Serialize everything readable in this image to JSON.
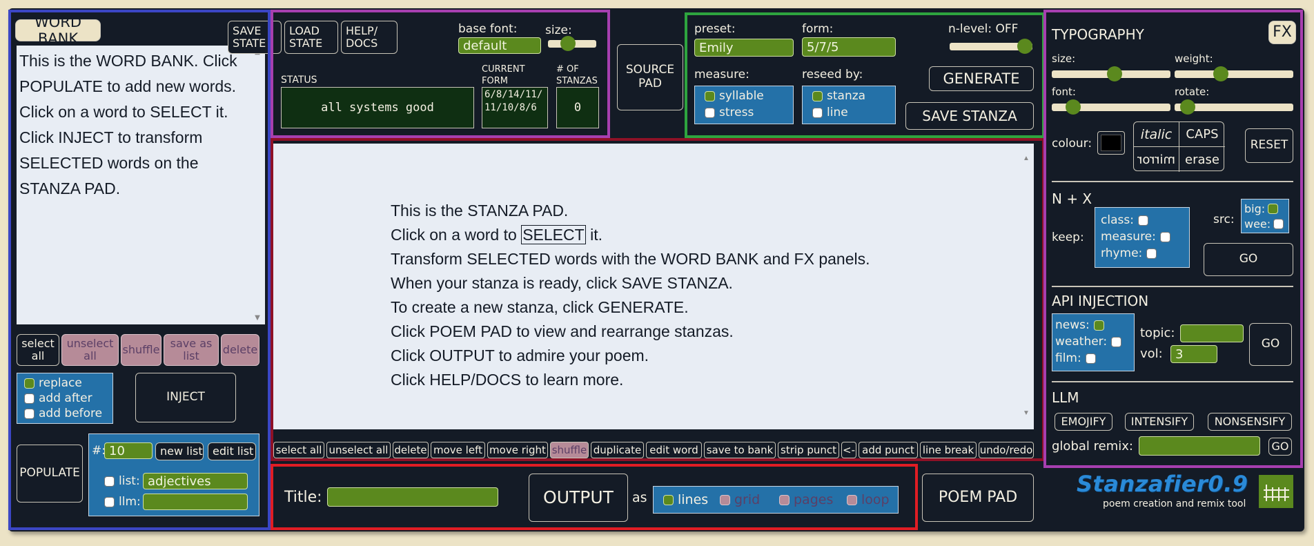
{
  "colors": {
    "background": "#ece3c6",
    "app_bg": "#141b26",
    "panel_green": "#5b891e",
    "panel_blue": "#2471a8",
    "pink_button": "#b68b98",
    "status_green": "#0f2f12",
    "frame_word_bank": "#3b46c4",
    "frame_file": "#a73fb0",
    "frame_generate": "#2ea43f",
    "frame_stanza": "#8e1126",
    "frame_output": "#e01d24",
    "frame_fx": "#a73fb0"
  },
  "word_bank": {
    "title": "WORD BANK",
    "text": "This is the WORD BANK. Click POPULATE to add new words. Click on a word to SELECT it. Click INJECT to transform SELECTED words on the STANZA PAD.",
    "buttons": [
      "select all",
      "unselect all",
      "shuffle",
      "save as list",
      "delete"
    ],
    "mode_options": [
      "replace",
      "add after",
      "add before"
    ],
    "inject_label": "INJECT",
    "populate_label": "POPULATE",
    "count_label": "#:",
    "count_value": "10",
    "new_list_label": "new list",
    "edit_list_label": "edit list",
    "list_label": "list:",
    "list_value": "adjectives",
    "llm_label": "llm:",
    "llm_value": ""
  },
  "file_panel": {
    "save_state": "SAVE STATE",
    "load_state": "LOAD STATE",
    "help_docs": "HELP/ DOCS",
    "base_font_label": "base font:",
    "base_font_value": "default",
    "size_label": "size:",
    "status_label": "STATUS",
    "status_value": "all systems good",
    "current_form_label": "CURRENT FORM",
    "current_form_value": "6/8/14/11/11/10/8/6",
    "stanzas_label": "# OF STANZAS",
    "stanzas_value": "0"
  },
  "source_pad_label": "SOURCE PAD",
  "generate_panel": {
    "preset_label": "preset:",
    "preset_value": "Emily",
    "form_label": "form:",
    "form_value": "5/7/5",
    "nlevel_label": "n-level: OFF",
    "measure_label": "measure:",
    "measure_options": [
      "syllable",
      "stress"
    ],
    "reseed_label": "reseed by:",
    "reseed_options": [
      "stanza",
      "line"
    ],
    "generate_label": "GENERATE",
    "save_stanza_label": "SAVE STANZA"
  },
  "stanza_pad": {
    "lines": [
      "This is the STANZA PAD.",
      "Click on a word to ",
      "Transform SELECTED words with the WORD BANK and FX panels.",
      "When your stanza is ready, click SAVE STANZA.",
      "To create a new stanza, click GENERATE.",
      "Click POEM PAD to view and rearrange stanzas.",
      "Click OUTPUT to admire your poem.",
      "Click HELP/DOCS to learn more."
    ],
    "selected_word": "SELECT",
    "line2_tail": " it.",
    "toolbar": [
      "select all",
      "unselect all",
      "delete",
      "move left",
      "move right",
      "shuffle",
      "duplicate",
      "edit word",
      "save to bank",
      "strip punct",
      "<-",
      "add punct",
      "line break",
      "undo/redo"
    ]
  },
  "output_panel": {
    "title_label": "Title:",
    "title_value": "",
    "output_label": "OUTPUT",
    "as_label": "as",
    "modes": [
      "lines",
      "grid",
      "pages",
      "loop"
    ],
    "poem_pad_label": "POEM PAD"
  },
  "brand": {
    "name": "Stanzafier0.9",
    "tagline": "poem creation and remix tool"
  },
  "fx_panel": {
    "typography_label": "TYPOGRAPHY",
    "fx_label": "FX",
    "size_label": "size:",
    "weight_label": "weight:",
    "font_label": "font:",
    "rotate_label": "rotate:",
    "colour_label": "colour:",
    "italic_label": "italic",
    "caps_label": "CAPS",
    "mirror_label": "mirror",
    "erase_label": "erase",
    "reset_label": "RESET",
    "nx_label": "N + X",
    "keep_label": "keep:",
    "keep_options": [
      "class:",
      "measure:",
      "rhyme:"
    ],
    "src_label": "src:",
    "src_options": [
      "big:",
      "wee:"
    ],
    "nx_go": "GO",
    "api_label": "API INJECTION",
    "api_options": [
      "news:",
      "weather:",
      "film:"
    ],
    "topic_label": "topic:",
    "topic_value": "",
    "vol_label": "vol:",
    "vol_value": "3",
    "api_go": "GO",
    "llm_label": "LLM",
    "llm_buttons": [
      "EMOJIFY",
      "INTENSIFY",
      "NONSENSIFY"
    ],
    "global_remix_label": "global remix:",
    "global_remix_value": "",
    "llm_go": "GO"
  }
}
